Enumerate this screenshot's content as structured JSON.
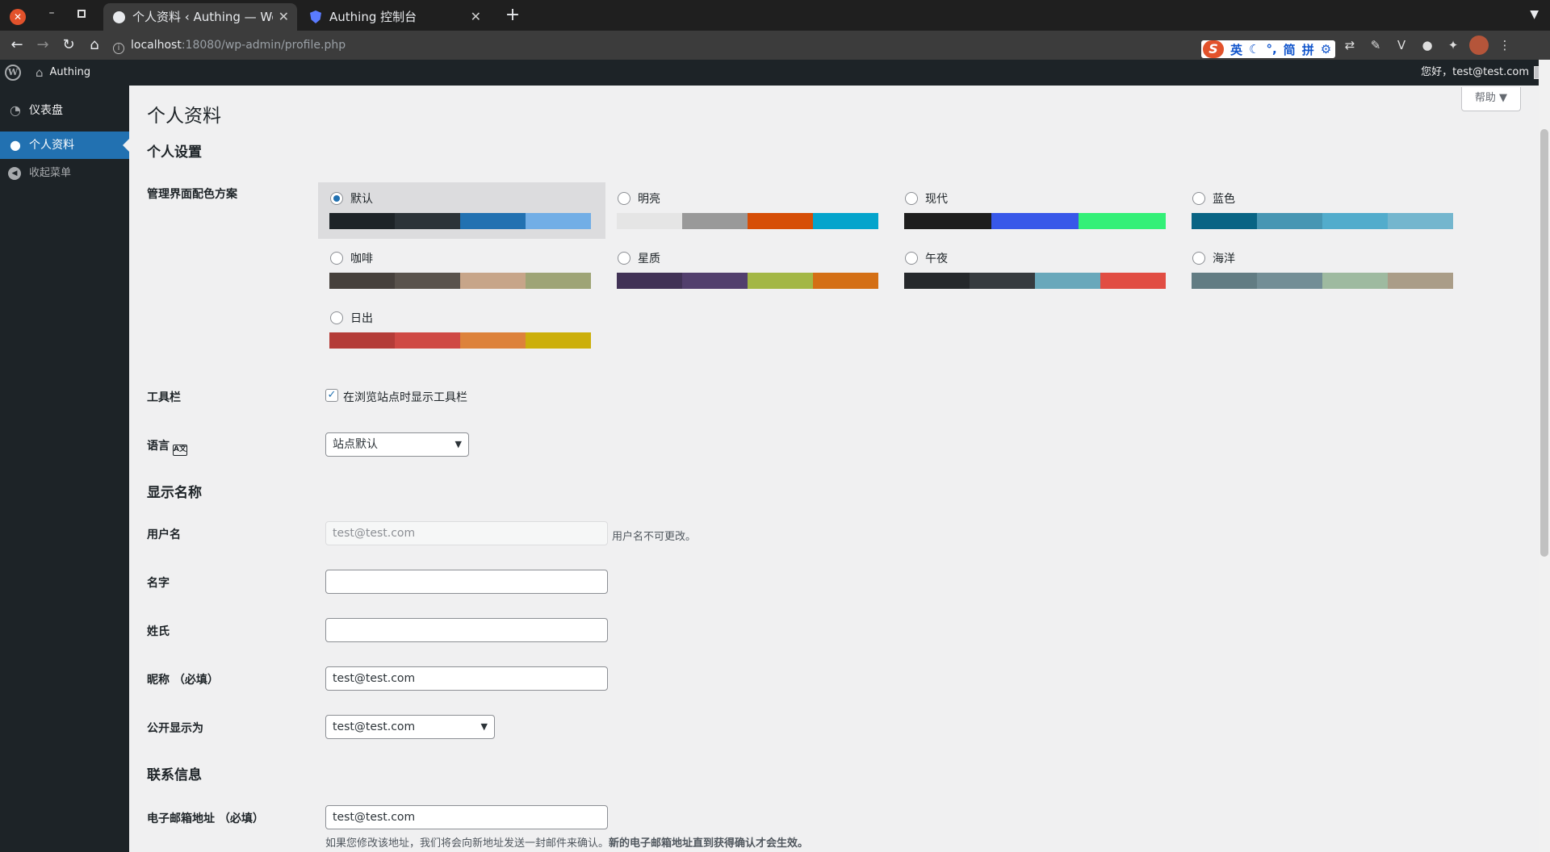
{
  "browser": {
    "tabs": [
      {
        "title": "个人资料 ‹ Authing — WordPress",
        "active": true
      },
      {
        "title": "Authing 控制台",
        "active": false
      }
    ],
    "url_host": "localhost",
    "url_path": ":18080/wp-admin/profile.php",
    "ime": {
      "label_en": "英",
      "label_jian": "简",
      "label_pin": "拼"
    }
  },
  "adminbar": {
    "site_name": "Authing",
    "howdy": "您好，test@test.com"
  },
  "sidebar": {
    "items": [
      {
        "label": "仪表盘",
        "icon": "dashboard-icon"
      },
      {
        "label": "个人资料",
        "icon": "user-icon",
        "current": true
      }
    ],
    "collapse_label": "收起菜单"
  },
  "content": {
    "help_label": "帮助 ▼",
    "page_title": "个人资料",
    "personal_options_heading": "个人设置",
    "color_scheme_label": "管理界面配色方案",
    "schemes": [
      {
        "name": "默认",
        "selected": true,
        "colors": [
          "#1d2327",
          "#2c3338",
          "#2271b1",
          "#72aee6"
        ]
      },
      {
        "name": "明亮",
        "selected": false,
        "colors": [
          "#e5e5e5",
          "#999999",
          "#d64e07",
          "#04a4cc"
        ]
      },
      {
        "name": "现代",
        "selected": false,
        "colors": [
          "#1e1e1e",
          "#3858e9",
          "#33f078"
        ]
      },
      {
        "name": "蓝色",
        "selected": false,
        "colors": [
          "#096484",
          "#4796b3",
          "#52accc",
          "#74b6ce"
        ]
      },
      {
        "name": "咖啡",
        "selected": false,
        "colors": [
          "#46403c",
          "#59524c",
          "#c7a589",
          "#9ea476"
        ]
      },
      {
        "name": "星质",
        "selected": false,
        "colors": [
          "#413256",
          "#523f6d",
          "#a3b745",
          "#d46f15"
        ]
      },
      {
        "name": "午夜",
        "selected": false,
        "colors": [
          "#25282b",
          "#363b3f",
          "#69a8bb",
          "#e14d43"
        ]
      },
      {
        "name": "海洋",
        "selected": false,
        "colors": [
          "#627c83",
          "#738e96",
          "#9ebaa0",
          "#aa9d88"
        ]
      },
      {
        "name": "日出",
        "selected": false,
        "colors": [
          "#b43c38",
          "#cf4944",
          "#dd823b",
          "#ccaf0b"
        ]
      }
    ],
    "toolbar_label": "工具栏",
    "toolbar_checkbox_label": "在浏览站点时显示工具栏",
    "toolbar_checked": true,
    "language_label": "语言",
    "language_value": "站点默认",
    "name_heading": "显示名称",
    "username_label": "用户名",
    "username_value": "test@test.com",
    "username_desc": "用户名不可更改。",
    "first_name_label": "名字",
    "first_name_value": "",
    "last_name_label": "姓氏",
    "last_name_value": "",
    "nickname_label": "昵称 （必填）",
    "nickname_value": "test@test.com",
    "display_name_label": "公开显示为",
    "display_name_value": "test@test.com",
    "contact_heading": "联系信息",
    "email_label": "电子邮箱地址 （必填）",
    "email_value": "test@test.com",
    "email_desc": "如果您修改该地址，我们将会向新地址发送一封邮件来确认。",
    "email_desc_bold": "新的电子邮箱地址直到获得确认才会生效。"
  }
}
